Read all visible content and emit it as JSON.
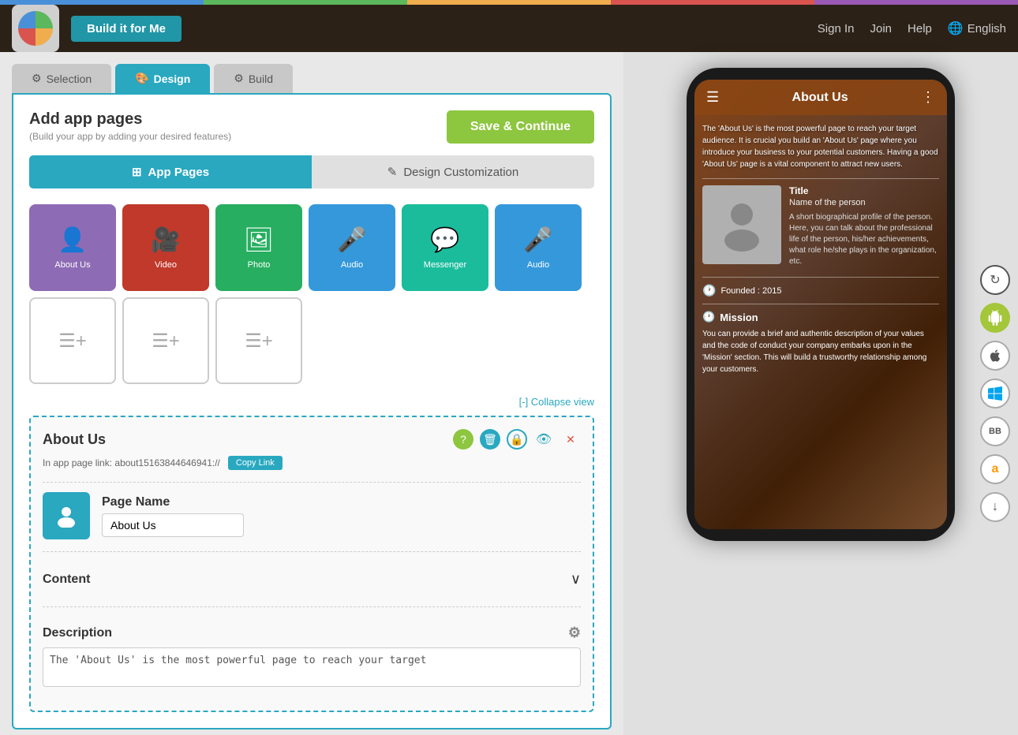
{
  "topBar": {
    "colors": [
      "#4a90d9",
      "#5cb85c",
      "#f0ad4e",
      "#d9534f",
      "#9b59b6"
    ]
  },
  "header": {
    "buildBtn": "Build it for Me",
    "signIn": "Sign In",
    "join": "Join",
    "help": "Help",
    "language": "English"
  },
  "tabs": {
    "selection": "Selection",
    "design": "Design",
    "build": "Build"
  },
  "main": {
    "title": "Add app pages",
    "subtitle": "(Build your app by adding your desired features)",
    "saveBtn": "Save & Continue"
  },
  "subTabs": {
    "appPages": "App Pages",
    "designCustomization": "Design Customization"
  },
  "pages": [
    {
      "label": "About Us",
      "color": "purple",
      "icon": "person"
    },
    {
      "label": "Video",
      "color": "red",
      "icon": "video"
    },
    {
      "label": "Photo",
      "color": "green",
      "icon": "photo"
    },
    {
      "label": "Audio",
      "color": "blue",
      "icon": "mic"
    },
    {
      "label": "Messenger",
      "color": "teal",
      "icon": "chat"
    },
    {
      "label": "Audio",
      "color": "blue",
      "icon": "mic"
    },
    {
      "label": "",
      "color": "empty",
      "icon": "plus"
    },
    {
      "label": "",
      "color": "empty",
      "icon": "plus"
    },
    {
      "label": "",
      "color": "empty",
      "icon": "plus"
    }
  ],
  "collapseView": "[-] Collapse view",
  "aboutUsPanel": {
    "title": "About Us",
    "appLink": "In app page link: about15163844646941://",
    "copyBtn": "Copy Link",
    "pageName": {
      "label": "Page Name",
      "value": "About Us"
    },
    "content": {
      "label": "Content"
    },
    "description": {
      "label": "Description",
      "value": "The 'About Us' is the most powerful page to reach your target"
    }
  },
  "phone": {
    "title": "About Us",
    "description": "The 'About Us' is the most powerful page to reach your target audience. It is crucial you build an 'About Us' page where you introduce your business to your potential customers. Having a good 'About Us' page is a vital component to attract new users.",
    "personTitle": "Title",
    "personName": "Name of the person",
    "personBio": "A short biographical profile of the person. Here, you can talk about the professional life of the person, his/her achievements, what role he/she plays in the organization, etc.",
    "founded": "Founded : 2015",
    "mission": "Mission",
    "missionText": "You can provide a brief and authentic description of your values and the code of conduct your company embarks upon in the 'Mission' section. This will build a trustworthy relationship among your customers."
  },
  "sideIcons": [
    {
      "name": "sync-icon",
      "symbol": "↻"
    },
    {
      "name": "android-icon",
      "symbol": "⚙"
    },
    {
      "name": "apple-icon",
      "symbol": ""
    },
    {
      "name": "windows-icon",
      "symbol": "⊞"
    },
    {
      "name": "blackberry-icon",
      "symbol": "BB"
    },
    {
      "name": "amazon-icon",
      "symbol": "a"
    },
    {
      "name": "download-icon",
      "symbol": "↓"
    }
  ]
}
